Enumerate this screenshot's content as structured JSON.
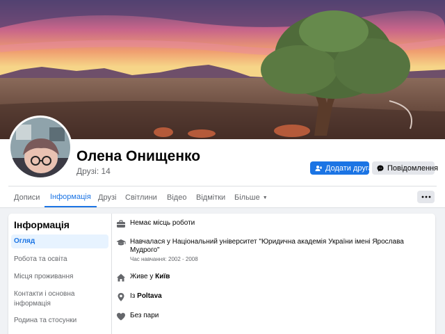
{
  "profile": {
    "name": "Олена Онищенко",
    "friends_count": "Друзі: 14",
    "add_friend_label": "Додати друга",
    "message_label": "Повідомлення"
  },
  "tabs": [
    {
      "label": "Дописи"
    },
    {
      "label": "Інформація",
      "active": true
    },
    {
      "label": "Друзі"
    },
    {
      "label": "Світлини"
    },
    {
      "label": "Відео"
    },
    {
      "label": "Відмітки"
    },
    {
      "label": "Більше"
    }
  ],
  "sidebar": {
    "title": "Інформація",
    "items": [
      {
        "label": "Огляд",
        "active": true
      },
      {
        "label": "Робота та освіта"
      },
      {
        "label": "Місця проживання"
      },
      {
        "label": "Контакти і основна інформація"
      },
      {
        "label": "Родина та стосунки"
      }
    ]
  },
  "overview": {
    "work": "Немає місць роботи",
    "education": "Навчалася у Національний університет \"Юридична академія України імені Ярослава Мудрого\"",
    "education_period": "Час навчання: 2002 - 2008",
    "lives_prefix": "Живе у ",
    "lives_city": "Київ",
    "from_prefix": "Із ",
    "from_city": "Poltava",
    "relationship": "Без пари"
  },
  "colors": {
    "accent": "#1b74e4",
    "background": "#f0f2f5",
    "secondary_text": "#65676b",
    "button_grey": "#e4e6eb"
  },
  "icons": [
    "add-friend-icon",
    "messenger-icon",
    "dots-icon",
    "briefcase-icon",
    "graduation-cap-icon",
    "home-icon",
    "location-pin-icon",
    "heart-icon"
  ]
}
